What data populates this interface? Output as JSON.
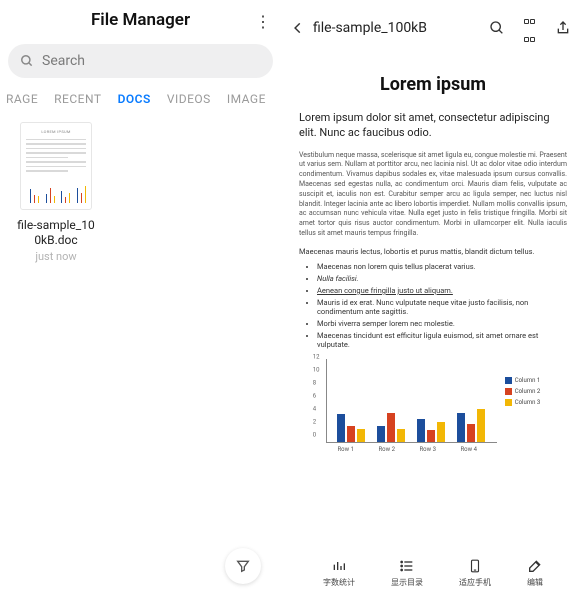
{
  "left": {
    "title": "File Manager",
    "search_placeholder": "Search",
    "tabs": [
      "RAGE",
      "RECENT",
      "DOCS",
      "VIDEOS",
      "IMAGE"
    ],
    "active_tab_index": 2,
    "files": [
      {
        "name_line1": "file-sample_10",
        "name_line2": "0kB.doc",
        "time": "just now"
      }
    ]
  },
  "right": {
    "doc_title": "file-sample_100kB",
    "h1": "Lorem ipsum",
    "sub": "Lorem ipsum dolor sit amet, consectetur adipiscing elit. Nunc ac faucibus odio.",
    "para": "Vestibulum neque massa, scelerisque sit amet ligula eu, congue molestie mi. Praesent ut varius sem. Nullam at porttitor arcu, nec lacinia nisl. Ut ac dolor vitae odio interdum condimentum. Vivamus dapibus sodales ex, vitae malesuada ipsum cursus convallis. Maecenas sed egestas nulla, ac condimentum orci. Mauris diam felis, vulputate ac suscipit et, iaculis non est. Curabitur semper arcu ac ligula semper, nec luctus nisl blandit. Integer lacinia ante ac libero lobortis imperdiet. Nullam mollis convallis ipsum, ac accumsan nunc vehicula vitae. Nulla eget justo in felis tristique fringilla. Morbi sit amet tortor quis risus auctor condimentum. Morbi in ullamcorper elit. Nulla iaculis tellus sit amet mauris tempus fringilla.",
    "line8": "Maecenas mauris lectus, lobortis et purus mattis, blandit dictum tellus.",
    "bullets": [
      "Maecenas non lorem quis tellus placerat varius.",
      "Nulla facilisi.",
      "Aenean congue fringilla justo ut aliquam.",
      "Mauris id ex erat. Nunc vulputate neque vitae justo facilisis, non condimentum ante sagittis.",
      "Morbi viverra semper lorem nec molestie.",
      "Maecenas tincidunt est efficitur ligula euismod, sit amet ornare est vulputate."
    ],
    "toolbar": [
      {
        "label": "字数统计"
      },
      {
        "label": "显示目录"
      },
      {
        "label": "适应手机"
      },
      {
        "label": "编辑"
      }
    ]
  },
  "chart_data": {
    "type": "bar",
    "categories": [
      "Row 1",
      "Row 2",
      "Row 3",
      "Row 4"
    ],
    "series": [
      {
        "name": "Column 1",
        "color": "#1c4e9c",
        "values": [
          4.3,
          2.5,
          3.5,
          4.5
        ]
      },
      {
        "name": "Column 2",
        "color": "#d64220",
        "values": [
          2.4,
          4.4,
          1.8,
          2.8
        ]
      },
      {
        "name": "Column 3",
        "color": "#f2b705",
        "values": [
          2.0,
          2.0,
          3.0,
          5.0
        ]
      }
    ],
    "ylim": [
      0,
      12
    ],
    "yticks": [
      0,
      2,
      4,
      6,
      8,
      10,
      12
    ]
  }
}
